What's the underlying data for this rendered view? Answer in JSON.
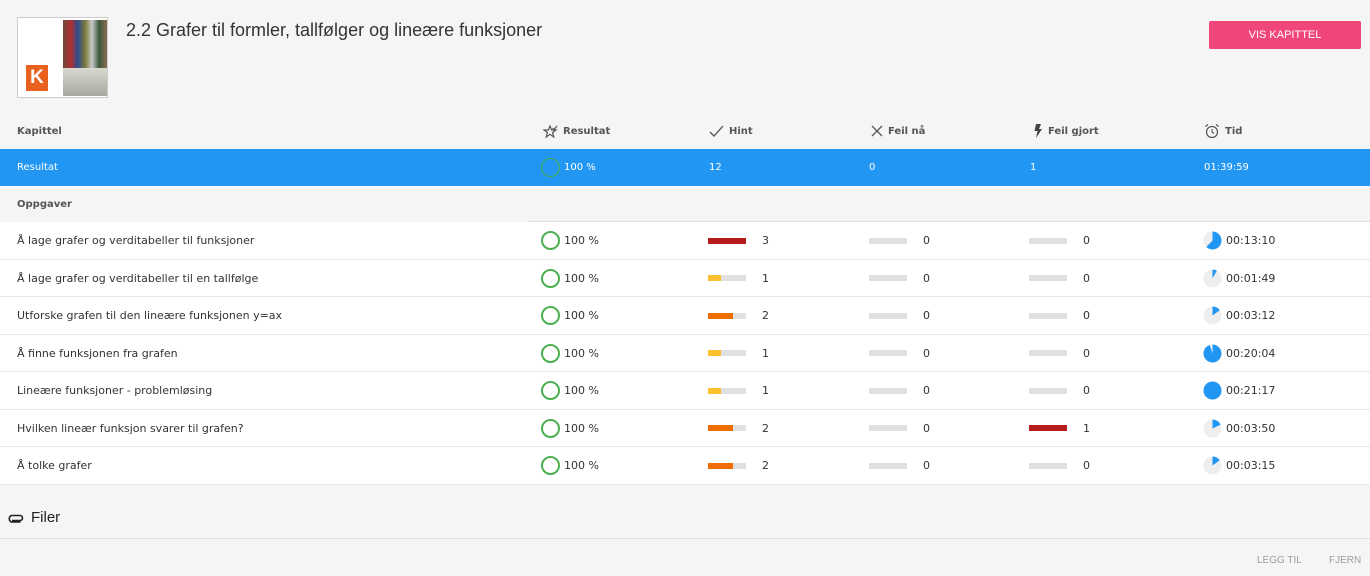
{
  "header": {
    "title": "2.2 Grafer til formler, tallfølger og lineære funksjoner",
    "logo_letter": "K",
    "primary_button": "VIS KAPITTEL",
    "accent_color": "#f0467a"
  },
  "columns": {
    "chapter": "Kapittel",
    "result": {
      "label": "Resultat",
      "icon": "star-check-icon"
    },
    "hint": {
      "label": "Hint",
      "icon": "checkmark-icon"
    },
    "error_now": {
      "label": "Feil nå",
      "icon": "x-icon"
    },
    "errors_made": {
      "label": "Feil gjort",
      "icon": "lightning-icon"
    },
    "time": {
      "label": "Tid",
      "icon": "alarm-clock-icon"
    }
  },
  "summary": {
    "label": "Resultat",
    "result": "100 %",
    "hint": "12",
    "error_now": "0",
    "errors_made": "1",
    "time": "01:39:59",
    "color": "#2196f3"
  },
  "section": {
    "label": "Oppgaver"
  },
  "tasks": [
    {
      "name": "Å lage grafer og verditabeller til funksjoner",
      "result": "100 %",
      "hint": "3",
      "hint_fill": 1.0,
      "hint_color": "#b71c1c",
      "error_now": "0",
      "errors_made": "0",
      "errors_fill": 0,
      "errors_color": "#b71c1c",
      "time": "00:13:10",
      "time_fraction": 0.62
    },
    {
      "name": "Å lage grafer og verditabeller til en tallfølge",
      "result": "100 %",
      "hint": "1",
      "hint_fill": 0.33,
      "hint_color": "#fbc02d",
      "error_now": "0",
      "errors_made": "0",
      "errors_fill": 0,
      "errors_color": "#b71c1c",
      "time": "00:01:49",
      "time_fraction": 0.08
    },
    {
      "name": "Utforske grafen til den lineære funksjonen y=ax",
      "result": "100 %",
      "hint": "2",
      "hint_fill": 0.66,
      "hint_color": "#ef6c00",
      "error_now": "0",
      "errors_made": "0",
      "errors_fill": 0,
      "errors_color": "#b71c1c",
      "time": "00:03:12",
      "time_fraction": 0.15
    },
    {
      "name": "Å finne funksjonen fra grafen",
      "result": "100 %",
      "hint": "1",
      "hint_fill": 0.33,
      "hint_color": "#fbc02d",
      "error_now": "0",
      "errors_made": "0",
      "errors_fill": 0,
      "errors_color": "#b71c1c",
      "time": "00:20:04",
      "time_fraction": 0.95
    },
    {
      "name": "Lineære funksjoner - problemløsing",
      "result": "100 %",
      "hint": "1",
      "hint_fill": 0.33,
      "hint_color": "#fbc02d",
      "error_now": "0",
      "errors_made": "0",
      "errors_fill": 0,
      "errors_color": "#b71c1c",
      "time": "00:21:17",
      "time_fraction": 1.0
    },
    {
      "name": "Hvilken lineær funksjon svarer til grafen?",
      "result": "100 %",
      "hint": "2",
      "hint_fill": 0.66,
      "hint_color": "#ef6c00",
      "error_now": "0",
      "errors_made": "1",
      "errors_fill": 1.0,
      "errors_color": "#b71c1c",
      "time": "00:03:50",
      "time_fraction": 0.18
    },
    {
      "name": "Å tolke grafer",
      "result": "100 %",
      "hint": "2",
      "hint_fill": 0.66,
      "hint_color": "#ef6c00",
      "error_now": "0",
      "errors_made": "0",
      "errors_fill": 0,
      "errors_color": "#b71c1c",
      "time": "00:03:15",
      "time_fraction": 0.15
    }
  ],
  "files": {
    "label": "Filer",
    "icon": "paperclip-icon",
    "add_label": "LEGG TIL",
    "remove_label": "FJERN"
  }
}
